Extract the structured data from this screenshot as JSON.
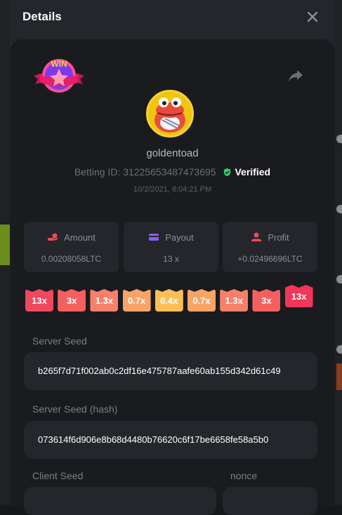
{
  "modal": {
    "title": "Details"
  },
  "bet": {
    "username": "goldentoad",
    "betting_id_label": "Betting ID:",
    "betting_id": "31225653487473695",
    "verified_label": "Verified",
    "datetime": "10/2/2021, 8:04:21 PM",
    "badge_text": "WIN"
  },
  "stats": {
    "amount": {
      "label": "Amount",
      "value": "0.00208058LTC",
      "icon": "coins-hand-icon"
    },
    "payout": {
      "label": "Payout",
      "value": "13 x",
      "icon": "card-icon"
    },
    "profit": {
      "label": "Profit",
      "value": "+0.02496696LTC",
      "icon": "hand-coin-icon"
    }
  },
  "multipliers": [
    {
      "label": "13x",
      "color": "#f0485e"
    },
    {
      "label": "3x",
      "color": "#f46060"
    },
    {
      "label": "1.3x",
      "color": "#f6806a"
    },
    {
      "label": "0.7x",
      "color": "#f8a466"
    },
    {
      "label": "0.4x",
      "color": "#fbbf56"
    },
    {
      "label": "0.7x",
      "color": "#f8a466"
    },
    {
      "label": "1.3x",
      "color": "#f6806a"
    },
    {
      "label": "3x",
      "color": "#f46060"
    },
    {
      "label": "13x",
      "color": "#f0365a",
      "selected": true
    }
  ],
  "seeds": {
    "server_seed_label": "Server Seed",
    "server_seed": "b265f7d71f002ab0c2df16e475787aafe60ab155d342d61c49",
    "server_seed_hash_label": "Server Seed (hash)",
    "server_seed_hash": "073614f6d906e8b68d4480b76620c6f17be6658fe58a5b0",
    "client_seed_label": "Client Seed",
    "nonce_label": "nonce"
  },
  "colors": {
    "verified_green": "#2ecc71",
    "amount_icon": "#f0485e",
    "payout_icon": "#8b5cf6",
    "profit_icon": "#f0485e"
  }
}
